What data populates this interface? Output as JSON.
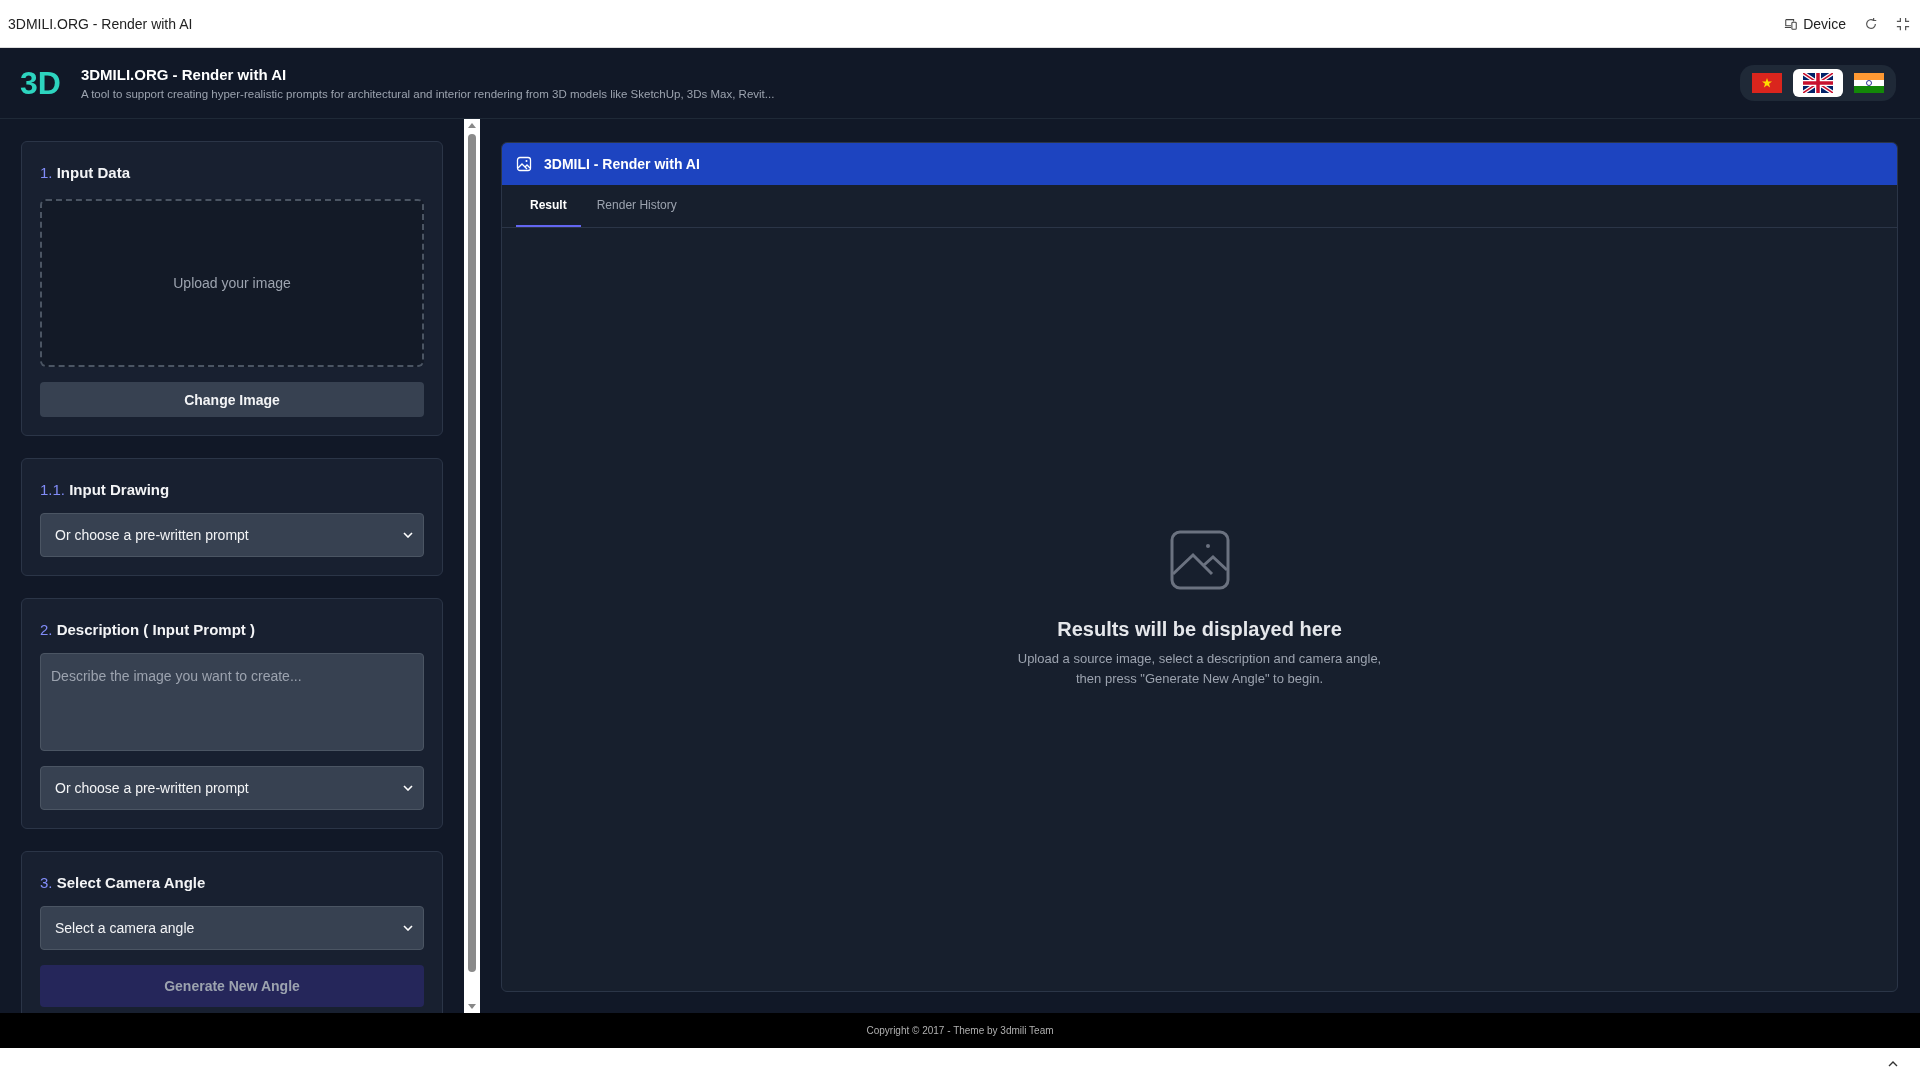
{
  "browser_bar": {
    "title": "3DMILI.ORG - Render with AI",
    "device_label": "Device"
  },
  "header": {
    "logo": "3D",
    "title": "3DMILI.ORG - Render with AI",
    "subtitle": "A tool to support creating hyper-realistic prompts for architectural and interior rendering from 3D models like SketchUp, 3Ds Max, Revit...",
    "languages": [
      {
        "kind": "vn",
        "selected": false
      },
      {
        "kind": "gb",
        "selected": true
      },
      {
        "kind": "in",
        "selected": false
      }
    ]
  },
  "sidebar": {
    "cards": [
      {
        "number": "1.",
        "title": "Input Data",
        "items": [
          {
            "kind": "dropzone",
            "text": "Upload your image"
          },
          {
            "kind": "button",
            "text": "Change Image",
            "disabled": false
          }
        ]
      },
      {
        "number": "1.1.",
        "title": "Input Drawing",
        "items": [
          {
            "kind": "select",
            "text": "Or choose a pre-written prompt"
          }
        ]
      },
      {
        "number": "2.",
        "title": "Description ( Input Prompt )",
        "items": [
          {
            "kind": "textarea",
            "placeholder": "Describe the image you want to create..."
          },
          {
            "kind": "select",
            "text": "Or choose a pre-written prompt"
          }
        ]
      },
      {
        "number": "3.",
        "title": "Select Camera Angle",
        "items": [
          {
            "kind": "select",
            "text": "Select a camera angle"
          },
          {
            "kind": "button",
            "text": "Generate New Angle",
            "disabled": true
          }
        ]
      }
    ]
  },
  "result_panel": {
    "title": "3DMILI - Render with AI",
    "tabs": [
      {
        "label": "Result",
        "selected": true
      },
      {
        "label": "Render History",
        "selected": false
      }
    ],
    "empty_state": {
      "heading": "Results will be displayed here",
      "text": "Upload a source image, select a description and camera angle,\nthen press \"Generate New Angle\" to begin."
    }
  },
  "footer": {
    "copyright": "Copyright © 2017 - Theme by 3dmili Team"
  }
}
